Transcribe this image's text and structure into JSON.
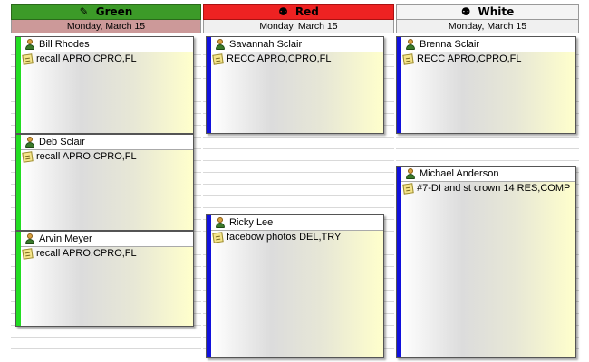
{
  "columns": [
    {
      "name": "Green",
      "icon": "tooth-brush-icon",
      "date": "Monday, March 15",
      "header_color": "#3c9a28",
      "date_color": "#cc9999",
      "provider_color": "#22dd22",
      "appointments": [
        {
          "patient": "Bill Rhodes",
          "note": "recall APRO,CPRO,FL"
        },
        {
          "patient": "Deb Sclair",
          "note": "recall APRO,CPRO,FL"
        },
        {
          "patient": "Arvin Meyer",
          "note": "recall APRO,CPRO,FL"
        }
      ]
    },
    {
      "name": "Red",
      "icon": "dental-chair-icon",
      "date": "Monday, March 15",
      "header_color": "#ee2222",
      "date_color": "#f0f0f0",
      "provider_color": "#1111dd",
      "appointments": [
        {
          "patient": "Savannah Sclair",
          "note": "RECC APRO,CPRO,FL"
        },
        {
          "patient": "Ricky Lee",
          "note": "facebow photos DEL,TRY"
        }
      ]
    },
    {
      "name": "White",
      "icon": "dental-chair-icon",
      "date": "Monday, March 15",
      "header_color": "#f4f4f4",
      "date_color": "#f0f0f0",
      "provider_color": "#1111dd",
      "appointments": [
        {
          "patient": "Brenna Sclair",
          "note": "RECC APRO,CPRO,FL"
        },
        {
          "patient": "Michael Anderson",
          "note": "#7-DI and st crown 14 RES,COMP"
        }
      ]
    }
  ]
}
